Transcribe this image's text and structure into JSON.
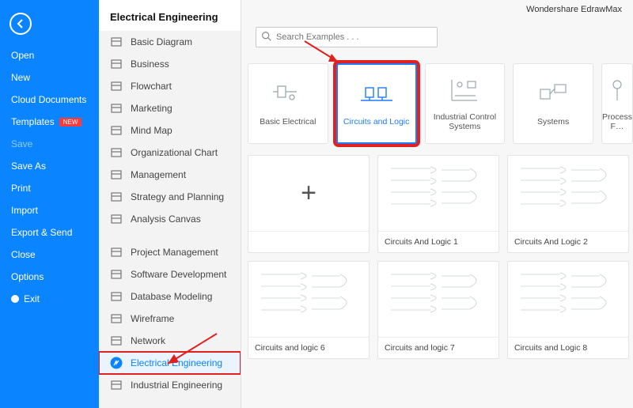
{
  "brand": "Wondershare EdrawMax",
  "sidebar": {
    "items": [
      {
        "label": "Open"
      },
      {
        "label": "New"
      },
      {
        "label": "Cloud Documents"
      },
      {
        "label": "Templates",
        "badge": "NEW"
      },
      {
        "label": "Save",
        "disabled": true
      },
      {
        "label": "Save As"
      },
      {
        "label": "Print"
      },
      {
        "label": "Import"
      },
      {
        "label": "Export & Send"
      },
      {
        "label": "Close"
      },
      {
        "label": "Options"
      },
      {
        "label": "Exit",
        "exit": true
      }
    ]
  },
  "cats": {
    "title": "Electrical Engineering",
    "groups": [
      [
        "Basic Diagram",
        "Business",
        "Flowchart",
        "Marketing",
        "Mind Map",
        "Organizational Chart",
        "Management",
        "Strategy and Planning",
        "Analysis Canvas"
      ],
      [
        "Project Management",
        "Software Development",
        "Database Modeling",
        "Wireframe",
        "Network",
        "Electrical Engineering",
        "Industrial Engineering"
      ]
    ],
    "selected": "Electrical Engineering"
  },
  "search": {
    "placeholder": "Search Examples . . ."
  },
  "types": [
    {
      "label": "Basic Electrical"
    },
    {
      "label": "Circuits and Logic",
      "selected": true,
      "annot": true
    },
    {
      "label": "Industrial Control Systems"
    },
    {
      "label": "Systems"
    },
    {
      "label": "Process F…"
    }
  ],
  "templates": [
    {
      "label": "",
      "blank": true
    },
    {
      "label": "Circuits And Logic 1"
    },
    {
      "label": "Circuits And Logic 2"
    },
    {
      "label": "Circuits and logic 6"
    },
    {
      "label": "Circuits and logic 7"
    },
    {
      "label": "Circuits and Logic 8"
    }
  ]
}
